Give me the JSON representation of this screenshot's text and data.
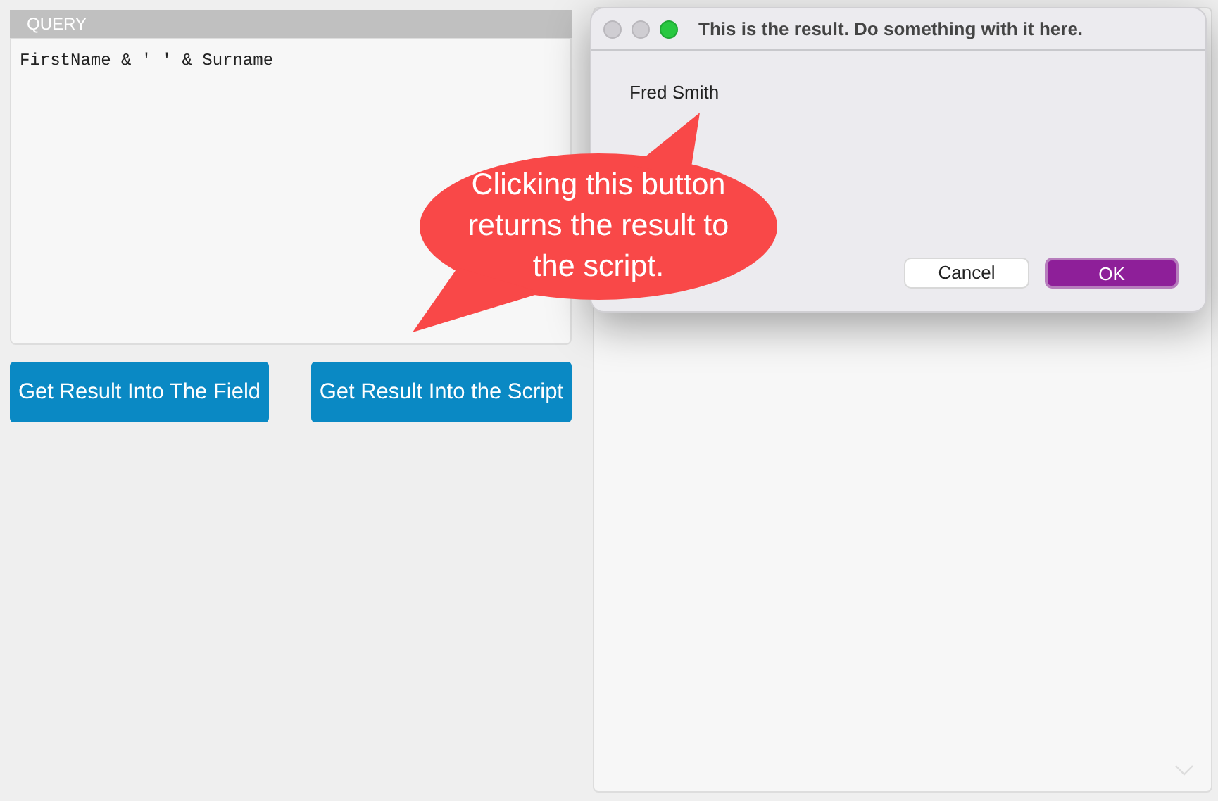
{
  "query": {
    "label": "QUERY",
    "value": "FirstName & ' ' & Surname"
  },
  "buttons": [
    {
      "label": "Get Result Into The Field"
    },
    {
      "label": "Get Result Into the Script"
    }
  ],
  "dialog": {
    "title": "This is the result. Do something with it here.",
    "message": "Fred Smith",
    "buttons": [
      {
        "label": "Cancel",
        "kind": "default"
      },
      {
        "label": "OK",
        "kind": "primary"
      }
    ]
  },
  "callout": {
    "text": "Clicking this button returns the result to the script."
  }
}
